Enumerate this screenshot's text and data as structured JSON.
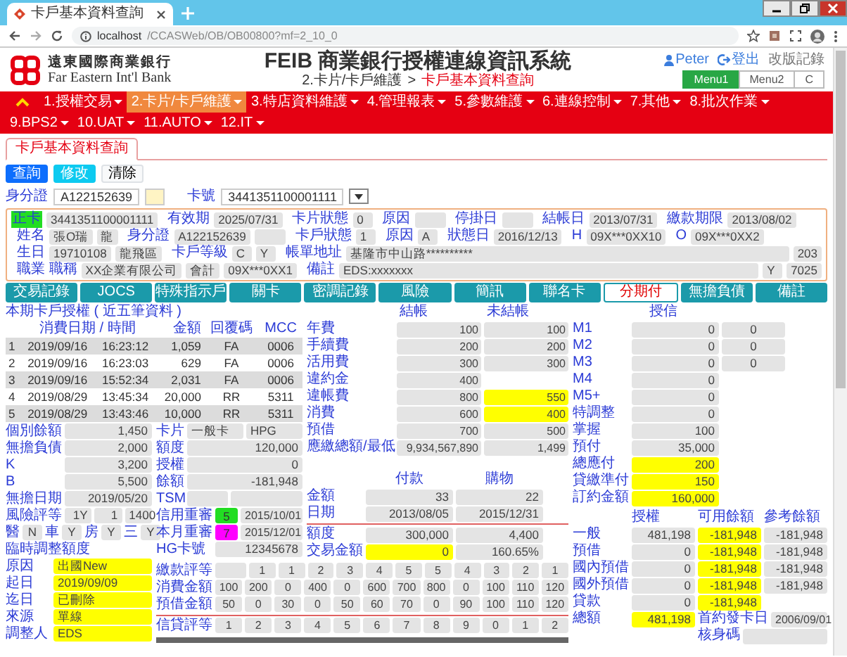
{
  "browser": {
    "tab_title": "卡戶基本資料查詢",
    "url_host": "localhost",
    "url_path": "/CCASWeb/OB/OB00800?mf=2_10_0"
  },
  "header": {
    "bank_name": "遠東國際商業銀行",
    "bank_name_en": "Far Eastern Int'l Bank",
    "title": "FEIB 商業銀行授權連線資訊系統",
    "breadcrumb_parent": "2.卡片/卡戶維護",
    "breadcrumb_separator": ">",
    "breadcrumb_current": "卡戶基本資料查詢",
    "user": "Peter",
    "logout": "登出",
    "changelog": "改版記錄",
    "menus": [
      {
        "label": "Menu1",
        "selected": true
      },
      {
        "label": "Menu2",
        "selected": false
      },
      {
        "label": "C",
        "selected": false
      }
    ]
  },
  "nav": [
    {
      "label": "1.授權交易",
      "selected": false
    },
    {
      "label": "2.卡片/卡戶維護",
      "selected": true
    },
    {
      "label": "3.特店資料維護",
      "selected": false
    },
    {
      "label": "4.管理報表",
      "selected": false
    },
    {
      "label": "5.參數維護",
      "selected": false
    },
    {
      "label": "6.連線控制",
      "selected": false
    },
    {
      "label": "7.其他",
      "selected": false
    },
    {
      "label": "8.批次作業",
      "selected": false
    },
    {
      "label": "9.BPS2",
      "selected": false
    },
    {
      "label": "10.UAT",
      "selected": false
    },
    {
      "label": "11.AUTO",
      "selected": false
    },
    {
      "label": "12.IT",
      "selected": false
    }
  ],
  "page_tab": "卡戶基本資料查詢",
  "actions": [
    {
      "label": "查詢",
      "kind": "primary"
    },
    {
      "label": "修改",
      "kind": "info"
    },
    {
      "label": "清除",
      "kind": "secondary"
    }
  ],
  "search": {
    "id_label": "身分證",
    "id_value": "A122152639",
    "card_label": "卡號",
    "card_value": "3441351100001111"
  },
  "info_rows": [
    [
      {
        "kind": "tag",
        "text": "正卡"
      },
      {
        "kind": "value",
        "text": "3441351100001111"
      },
      {
        "kind": "label",
        "text": "有效期"
      },
      {
        "kind": "value",
        "text": "2025/07/31"
      },
      {
        "kind": "label",
        "text": "卡片狀態"
      },
      {
        "kind": "value",
        "text": "0"
      },
      {
        "kind": "label",
        "text": "原因"
      },
      {
        "kind": "value"
      },
      {
        "kind": "label",
        "text": "停掛日"
      },
      {
        "kind": "value"
      },
      {
        "kind": "label",
        "text": "結帳日"
      },
      {
        "kind": "value",
        "text": "2013/07/31"
      },
      {
        "kind": "label",
        "text": "繳款期限"
      },
      {
        "kind": "value",
        "text": "2013/08/02"
      }
    ],
    [
      {
        "kind": "label",
        "text": "姓名"
      },
      {
        "kind": "value",
        "text": "張O瑞"
      },
      {
        "kind": "value",
        "text": "龍"
      },
      {
        "kind": "label",
        "text": "身分證"
      },
      {
        "kind": "value",
        "text": "A122152639"
      },
      {
        "kind": "value"
      },
      {
        "kind": "label",
        "text": "卡戶狀態"
      },
      {
        "kind": "value",
        "text": "1"
      },
      {
        "kind": "label",
        "text": "原因"
      },
      {
        "kind": "value",
        "text": "A"
      },
      {
        "kind": "label",
        "text": "狀態日"
      },
      {
        "kind": "value",
        "text": "2016/12/13"
      },
      {
        "kind": "label",
        "text": "H"
      },
      {
        "kind": "value",
        "text": "09X***0XX10"
      },
      {
        "kind": "label",
        "text": "O"
      },
      {
        "kind": "value",
        "text": "09X***0XX2"
      }
    ],
    [
      {
        "kind": "label",
        "text": "生日"
      },
      {
        "kind": "value",
        "text": "19710108"
      },
      {
        "kind": "value",
        "text": "龍飛區"
      },
      {
        "kind": "label",
        "text": "卡戶等級"
      },
      {
        "kind": "value",
        "text": "C"
      },
      {
        "kind": "value",
        "text": "Y"
      },
      {
        "kind": "label",
        "text": "帳單地址"
      },
      {
        "kind": "wide",
        "text": "基隆市中山路**********"
      },
      {
        "kind": "value",
        "text": "203"
      }
    ],
    [
      {
        "kind": "label",
        "text": "職業 職稱"
      },
      {
        "kind": "value",
        "text": "XX企業有限公司"
      },
      {
        "kind": "value",
        "text": "會計"
      },
      {
        "kind": "value",
        "text": "09X***0XX1"
      },
      {
        "kind": "label",
        "text": "備註"
      },
      {
        "kind": "wide",
        "text": "EDS:xxxxxxx"
      },
      {
        "kind": "value",
        "text": "Y"
      },
      {
        "kind": "value",
        "text": "7025"
      }
    ]
  ],
  "sub_tabs": [
    {
      "label": "交易記錄",
      "highlight": false
    },
    {
      "label": "JOCS",
      "highlight": false
    },
    {
      "label": "特殊指示戶",
      "highlight": false
    },
    {
      "label": "關卡",
      "highlight": false
    },
    {
      "label": "密調記錄",
      "highlight": false
    },
    {
      "label": "風險",
      "highlight": false
    },
    {
      "label": "簡訊",
      "highlight": false
    },
    {
      "label": "聯名卡",
      "highlight": false
    },
    {
      "label": "分期付",
      "highlight": true
    },
    {
      "label": "無擔負債",
      "highlight": false
    },
    {
      "label": "備註",
      "highlight": false
    }
  ],
  "transactions": {
    "title": "本期卡戶授權 ( 近五筆資料 )",
    "columns": [
      "消費日期 / 時間",
      "金額",
      "回覆碼",
      "MCC"
    ],
    "rows": [
      {
        "no": "1",
        "date": "2019/09/16",
        "time": "16:23:12",
        "amount": "1,059",
        "code": "FA",
        "mcc": "0006"
      },
      {
        "no": "2",
        "date": "2019/09/16",
        "time": "16:23:03",
        "amount": "629",
        "code": "FA",
        "mcc": "0006"
      },
      {
        "no": "3",
        "date": "2019/09/16",
        "time": "15:52:34",
        "amount": "2,031",
        "code": "FA",
        "mcc": "0006"
      },
      {
        "no": "4",
        "date": "2019/08/29",
        "time": "13:45:34",
        "amount": "20,000",
        "code": "RR",
        "mcc": "5311"
      },
      {
        "no": "5",
        "date": "2019/08/29",
        "time": "13:43:46",
        "amount": "10,000",
        "code": "RR",
        "mcc": "5311"
      }
    ]
  },
  "fees": {
    "columns": [
      "結帳",
      "未結帳"
    ],
    "rows": [
      {
        "label": "年費",
        "values": [
          "100",
          "100"
        ],
        "highlight": false
      },
      {
        "label": "手續費",
        "values": [
          "200",
          "200"
        ],
        "highlight": false
      },
      {
        "label": "活用費",
        "values": [
          "300",
          "300"
        ],
        "highlight": false
      },
      {
        "label": "違約金",
        "values": [
          "400"
        ],
        "highlight": false
      },
      {
        "label": "違帳費",
        "values": [
          "800",
          "550"
        ],
        "highlight": true
      },
      {
        "label": "消費",
        "values": [
          "600",
          "400"
        ],
        "highlight": true
      },
      {
        "label": "預借",
        "values": [
          "700",
          "500"
        ],
        "highlight": false
      },
      {
        "label": "應繳總額/最低",
        "values": [
          "9,934,567,890",
          "1,499"
        ],
        "highlight": false
      }
    ]
  },
  "summary": [
    {
      "label": "個別餘額",
      "values": [
        "1,450"
      ]
    },
    {
      "label": "無擔負債",
      "values": [
        "2,000"
      ]
    },
    {
      "label": "K",
      "values": [
        "3,200"
      ]
    },
    {
      "label": "B",
      "values": [
        "5,500"
      ]
    },
    {
      "label": "無擔日期",
      "values": [
        "2019/05/20"
      ]
    },
    {
      "label": "風險評等",
      "values": [
        "1Y",
        "1",
        "1400"
      ]
    }
  ],
  "flags": [
    {
      "label": "醫",
      "value": "N"
    },
    {
      "label": "車",
      "value": "Y"
    },
    {
      "label": "房",
      "value": "Y"
    },
    {
      "label": "三",
      "value": "Y"
    }
  ],
  "temp_adjust": {
    "title": "臨時調整額度",
    "rows": [
      {
        "label": "原因",
        "value": "出國New"
      },
      {
        "label": "起日",
        "value": "2019/09/09"
      },
      {
        "label": "迄日",
        "value": "已刪除"
      },
      {
        "label": "來源",
        "value": "單線"
      },
      {
        "label": "調整人",
        "value": "EDS"
      }
    ]
  },
  "card_rows": [
    {
      "kind": "values",
      "label": "卡片",
      "values": [
        "一般卡",
        "HPG"
      ]
    },
    {
      "kind": "values",
      "label": "額度",
      "values": [
        "120,000"
      ]
    },
    {
      "kind": "values",
      "label": "授權",
      "values": [
        "0"
      ]
    },
    {
      "kind": "values",
      "label": "餘額",
      "values": [
        "-181,948"
      ]
    },
    {
      "kind": "blank",
      "label": "TSM"
    },
    {
      "kind": "badge",
      "label": "信用重審",
      "badge": "5",
      "color": "#22dd22",
      "date": "2015/10/01"
    },
    {
      "kind": "badge",
      "label": "本月重審",
      "badge": "7",
      "color": "#ff00ff",
      "date": "2015/12/01"
    },
    {
      "kind": "values",
      "label": "HG卡號",
      "values": [
        "12345678"
      ]
    }
  ],
  "payment": {
    "columns": [
      "付款",
      "購物"
    ],
    "rows": [
      {
        "label": "金額",
        "values": [
          "33",
          "22"
        ],
        "highlight": false
      },
      {
        "label": "日期",
        "values": [
          "2013/08/05",
          "2015/12/31"
        ],
        "highlight": false
      },
      {
        "label": "額度",
        "values": [
          "300,000",
          "4,400"
        ],
        "highlight": false
      },
      {
        "label": "交易金額",
        "values": [
          "0",
          "160.65%"
        ],
        "highlight": true
      }
    ]
  },
  "rating_grid": [
    {
      "label": "繳款評等",
      "kind": "offset",
      "values": [
        "1",
        "1",
        "2",
        "3",
        "4",
        "5",
        "5",
        "4",
        "3",
        "2",
        "1"
      ]
    },
    {
      "label": "消費金額",
      "values": [
        "100",
        "200",
        "0",
        "400",
        "0",
        "600",
        "700",
        "800",
        "0",
        "100",
        "110",
        "120"
      ]
    },
    {
      "label": "預借金額",
      "values": [
        "50",
        "0",
        "30",
        "0",
        "50",
        "60",
        "70",
        "0",
        "90",
        "100",
        "110",
        "120"
      ]
    },
    {
      "label": "信貸評等",
      "values": [
        "1",
        "2",
        "3",
        "4",
        "5",
        "6",
        "7",
        "8",
        "9",
        "0",
        "1",
        "2"
      ]
    }
  ],
  "credit": {
    "header": "授信",
    "delinquency": [
      {
        "label": "M1",
        "values": [
          "0",
          "0"
        ]
      },
      {
        "label": "M2",
        "values": [
          "0",
          "0"
        ]
      },
      {
        "label": "M3",
        "values": [
          "0",
          "0"
        ]
      },
      {
        "label": "M4",
        "values": [
          "0"
        ]
      },
      {
        "label": "M5+",
        "values": [
          "0"
        ]
      },
      {
        "label": "特調整",
        "values": [
          "0"
        ]
      },
      {
        "label": "掌握",
        "values": [
          "100"
        ]
      },
      {
        "label": "預付",
        "values": [
          "35,000"
        ]
      }
    ],
    "due": [
      {
        "label": "總應付",
        "value": "200",
        "highlight": true
      },
      {
        "label": "貸繳準付",
        "value": "150",
        "highlight": true
      },
      {
        "label": "訂約金額",
        "value": "160,000",
        "highlight": true
      }
    ]
  },
  "balances": {
    "columns": [
      {
        "label": "授權",
        "highlight": false
      },
      {
        "label": "可用餘額",
        "highlight": true
      },
      {
        "label": "參考餘額",
        "highlight": false
      }
    ],
    "rows": [
      {
        "label": "一般",
        "values": [
          "481,198",
          "-181,948",
          "-181,948"
        ]
      },
      {
        "label": "預借",
        "values": [
          "0",
          "-181,948",
          "-181,948"
        ]
      },
      {
        "label": "國內預借",
        "values": [
          "0",
          "-181,948",
          "-181,948"
        ]
      },
      {
        "label": "國外預借",
        "values": [
          "0",
          "-181,948",
          "-181,948"
        ]
      },
      {
        "label": "貸款",
        "values": [
          "0",
          "-181,948"
        ]
      }
    ],
    "total": {
      "label": "總額",
      "value": "481,198",
      "highlight": true
    },
    "first_issue": {
      "label": "首約發卡日",
      "value": "2006/09/01"
    },
    "verify_label": "核身碼"
  }
}
